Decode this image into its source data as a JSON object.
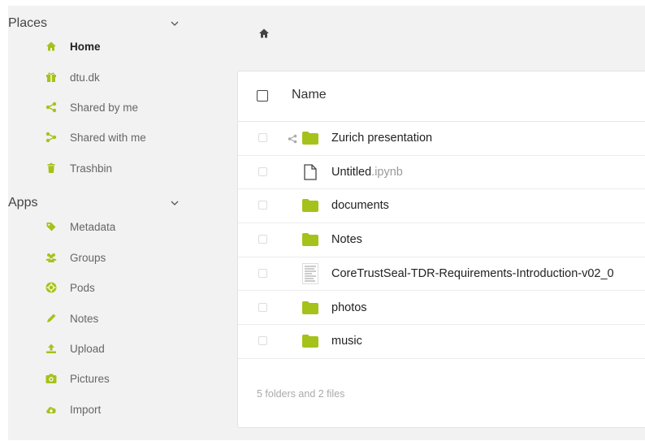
{
  "sidebar": {
    "places": {
      "title": "Places",
      "items": [
        {
          "label": "Home",
          "icon": "home-icon",
          "active": true
        },
        {
          "label": "dtu.dk",
          "icon": "gift-icon"
        },
        {
          "label": "Shared by me",
          "icon": "share-icon"
        },
        {
          "label": "Shared with me",
          "icon": "shared-with-me-icon"
        },
        {
          "label": "Trashbin",
          "icon": "trash-icon"
        }
      ]
    },
    "apps": {
      "title": "Apps",
      "items": [
        {
          "label": "Metadata",
          "icon": "tag-icon"
        },
        {
          "label": "Groups",
          "icon": "users-icon"
        },
        {
          "label": "Pods",
          "icon": "pods-icon"
        },
        {
          "label": "Notes",
          "icon": "pencil-icon"
        },
        {
          "label": "Upload",
          "icon": "upload-icon"
        },
        {
          "label": "Pictures",
          "icon": "camera-icon"
        },
        {
          "label": "Import",
          "icon": "cloud-download-icon"
        }
      ]
    }
  },
  "breadcrumb": {
    "icon": "home-icon"
  },
  "table": {
    "header_name": "Name",
    "rows": [
      {
        "name": "Zurich presentation",
        "ext": "",
        "type": "folder",
        "shared": true
      },
      {
        "name": "Untitled",
        "ext": ".ipynb",
        "type": "file"
      },
      {
        "name": "documents",
        "ext": "",
        "type": "folder"
      },
      {
        "name": "Notes",
        "ext": "",
        "type": "folder"
      },
      {
        "name": "CoreTrustSeal-TDR-Requirements-Introduction-v02_0",
        "ext": "",
        "type": "document"
      },
      {
        "name": "photos",
        "ext": "",
        "type": "folder"
      },
      {
        "name": "music",
        "ext": "",
        "type": "folder"
      }
    ],
    "summary": "5 folders and 2 files"
  },
  "colors": {
    "accent": "#a5c21a",
    "background": "#f2f2f2",
    "panel": "#ffffff"
  }
}
